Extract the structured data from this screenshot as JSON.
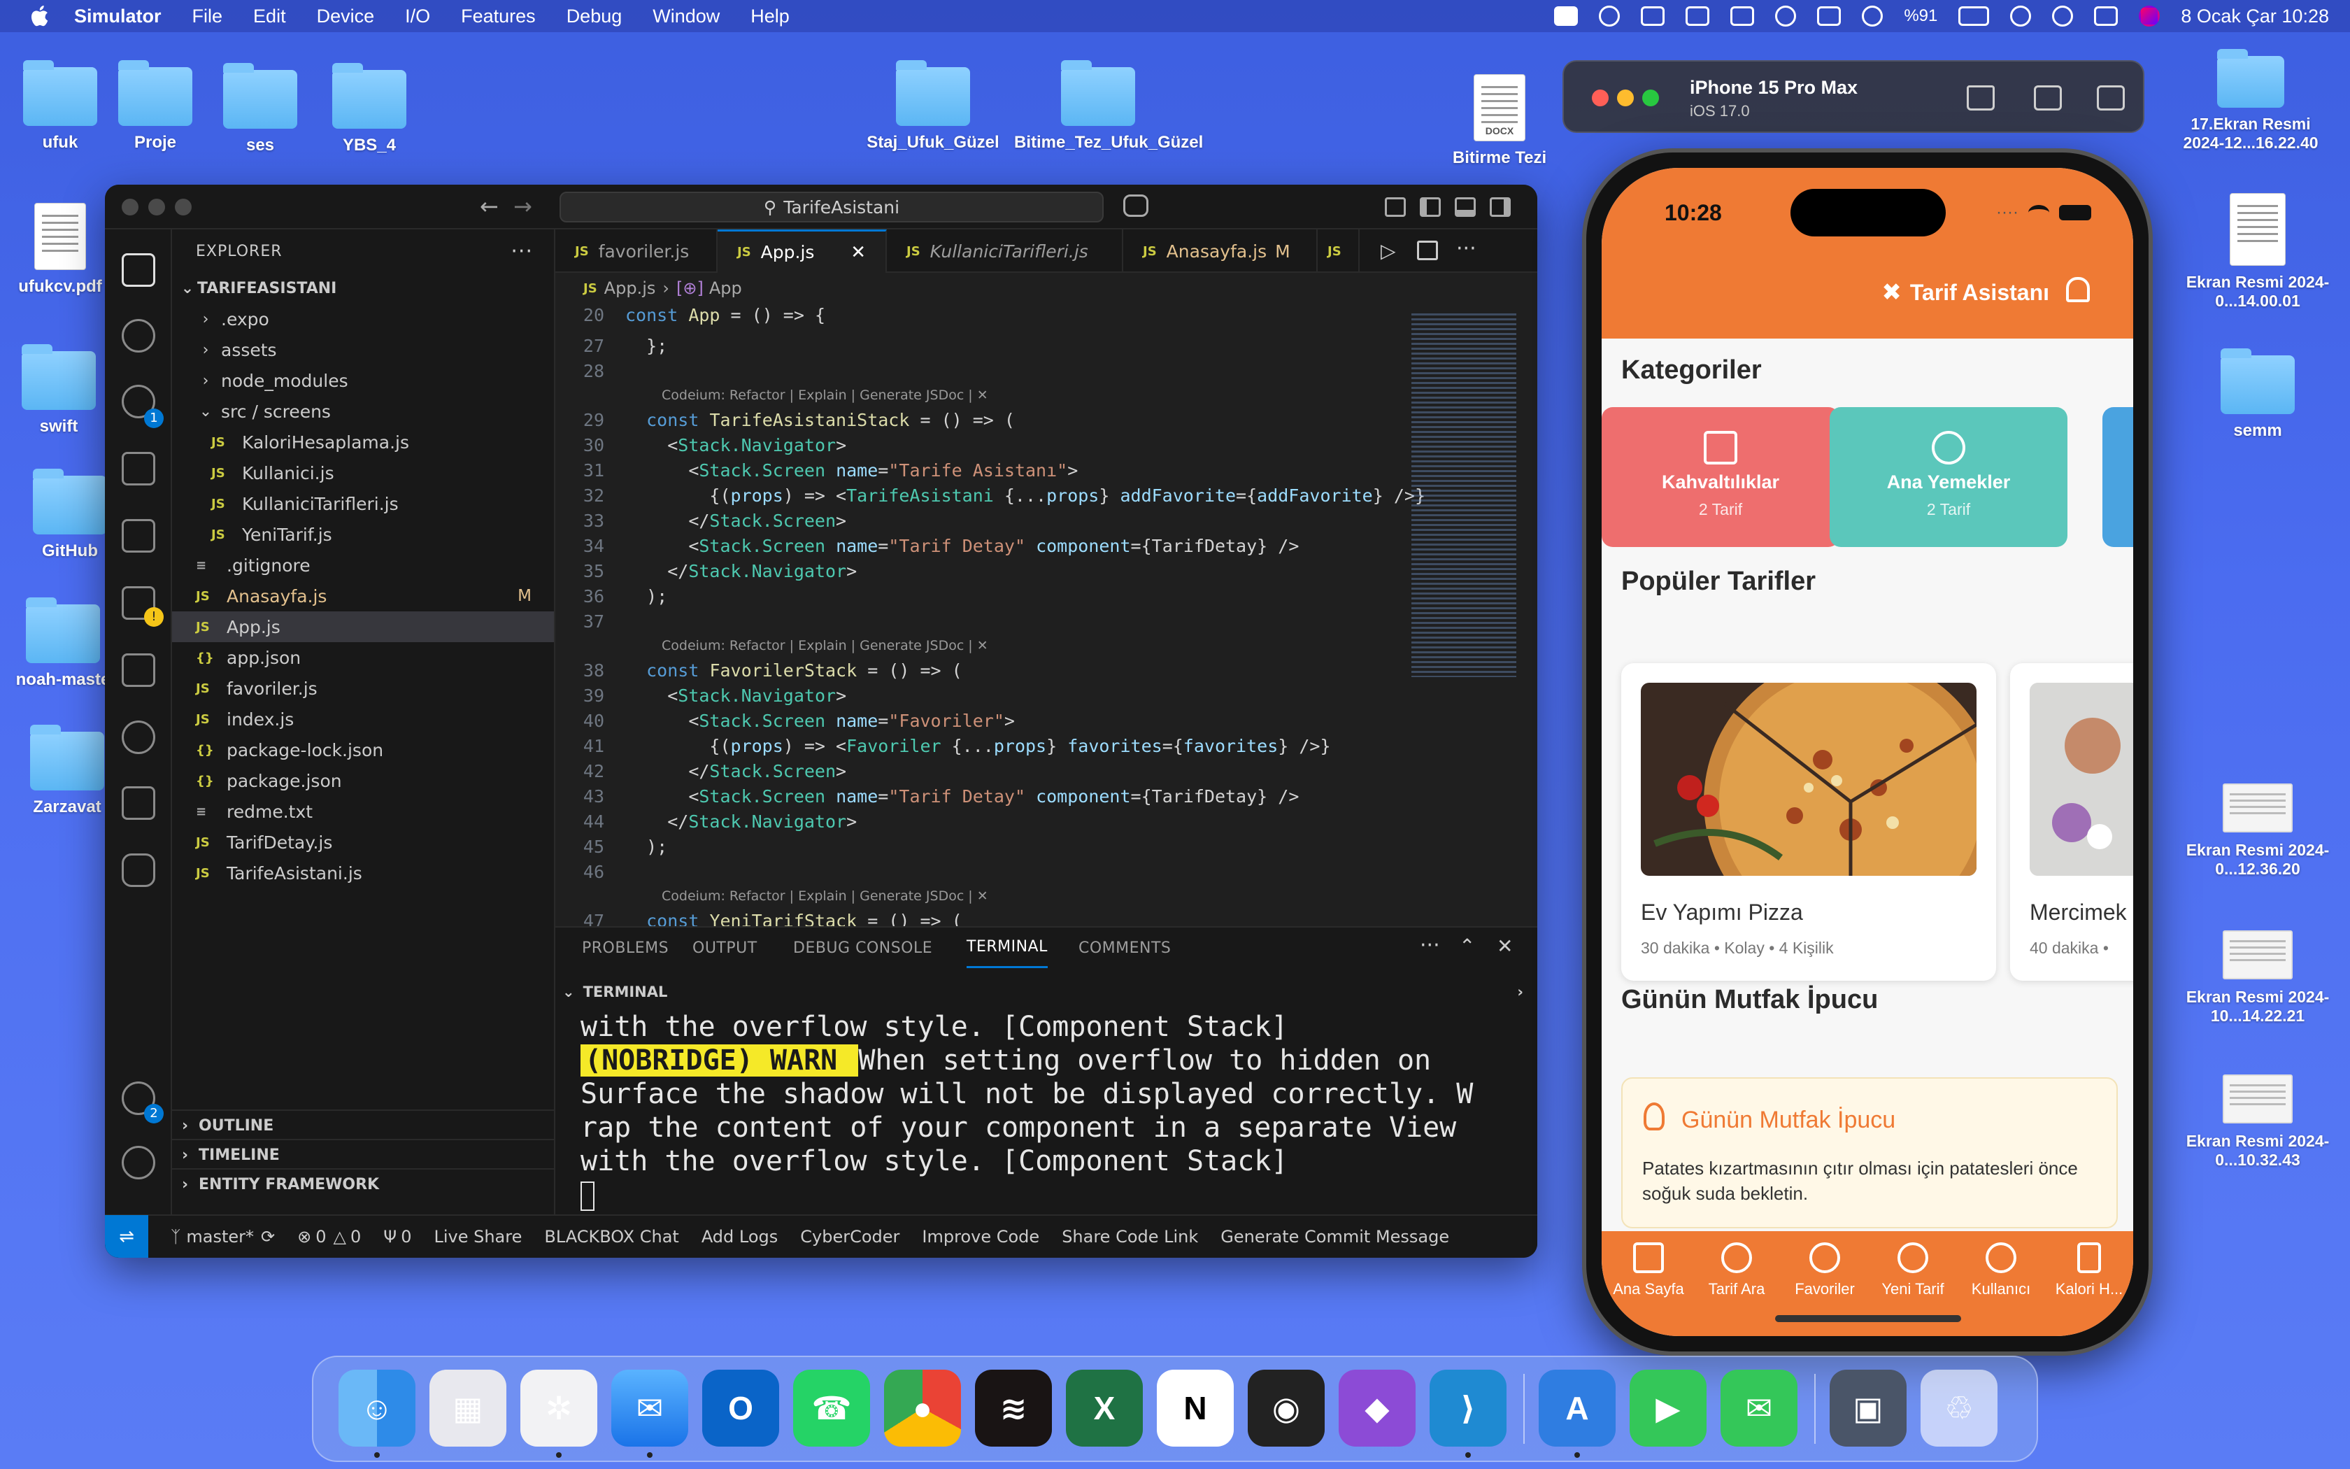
{
  "menubar": {
    "app_name": "Simulator",
    "items": [
      "File",
      "Edit",
      "Device",
      "I/O",
      "Features",
      "Debug",
      "Window",
      "Help"
    ],
    "battery": "%91",
    "clock": "8 Ocak Çar  10:28"
  },
  "desktop_icons": [
    {
      "label": "ufuk",
      "kind": "folder"
    },
    {
      "label": "Proje",
      "kind": "folder"
    },
    {
      "label": "ses",
      "kind": "folder"
    },
    {
      "label": "YBS_4",
      "kind": "folder"
    },
    {
      "label": "Staj_Ufuk_Güzel",
      "kind": "folder"
    },
    {
      "label": "Bitime_Tez_Ufuk_Güzel",
      "kind": "folder"
    },
    {
      "label": "Bitirme Tezi",
      "kind": "docx"
    },
    {
      "label": "ufukcv.pdf",
      "kind": "document"
    },
    {
      "label": "swift",
      "kind": "folder"
    },
    {
      "label": "GitHub",
      "kind": "folder"
    },
    {
      "label": "noah-maste",
      "kind": "folder"
    },
    {
      "label": "Zarzavat",
      "kind": "folder"
    },
    {
      "label": "semm",
      "kind": "folder"
    }
  ],
  "screenshots_right": [
    {
      "label": "17.Ekran Resmi 2024-12...16.22.40"
    },
    {
      "label": "Ekran Resmi 2024-0...14.00.01"
    },
    {
      "label": "Ekran Resmi 2024-0...12.36.20"
    },
    {
      "label": "Ekran Resmi 2024-10...14.22.21"
    },
    {
      "label": "Ekran Resmi 2024-0...10.32.43"
    }
  ],
  "vscode": {
    "search_text": "TarifeAsistani",
    "explorer_title": "EXPLORER",
    "project": "TARIFEASISTANI",
    "tree": [
      {
        "name": ".expo",
        "type": "folder",
        "depth": 1,
        "open": false
      },
      {
        "name": "assets",
        "type": "folder",
        "depth": 1,
        "open": false
      },
      {
        "name": "node_modules",
        "type": "folder",
        "depth": 1,
        "open": false
      },
      {
        "name": "src / screens",
        "type": "folder",
        "depth": 1,
        "open": true
      },
      {
        "name": "KaloriHesaplama.js",
        "type": "js",
        "depth": 2
      },
      {
        "name": "Kullanici.js",
        "type": "js",
        "depth": 2
      },
      {
        "name": "KullaniciTarifleri.js",
        "type": "js",
        "depth": 2
      },
      {
        "name": "YeniTarif.js",
        "type": "js",
        "depth": 2
      },
      {
        "name": ".gitignore",
        "type": "txt",
        "depth": 1
      },
      {
        "name": "Anasayfa.js",
        "type": "js",
        "depth": 1,
        "badge": "M"
      },
      {
        "name": "App.js",
        "type": "js",
        "depth": 1,
        "selected": true
      },
      {
        "name": "app.json",
        "type": "json",
        "depth": 1
      },
      {
        "name": "favoriler.js",
        "type": "js",
        "depth": 1
      },
      {
        "name": "index.js",
        "type": "js",
        "depth": 1
      },
      {
        "name": "package-lock.json",
        "type": "json",
        "depth": 1
      },
      {
        "name": "package.json",
        "type": "json",
        "depth": 1
      },
      {
        "name": "redme.txt",
        "type": "txt",
        "depth": 1
      },
      {
        "name": "TarifDetay.js",
        "type": "js",
        "depth": 1
      },
      {
        "name": "TarifeAsistani.js",
        "type": "js",
        "depth": 1
      }
    ],
    "sections": [
      "OUTLINE",
      "TIMELINE",
      "ENTITY FRAMEWORK"
    ],
    "tabs": [
      {
        "name": "favoriler.js"
      },
      {
        "name": "App.js",
        "active": true
      },
      {
        "name": "KullaniciTarifleri.js",
        "italic": true
      },
      {
        "name": "Anasayfa.js",
        "badge": "M"
      },
      {
        "name": ""
      }
    ],
    "breadcrumb": [
      "App.js",
      "App"
    ],
    "codelens": "Codeium: Refactor | Explain | Generate JSDoc | ✕",
    "code": [
      {
        "n": "20",
        "t": "const App = () => {"
      },
      {
        "n": "27",
        "t": "  };"
      },
      {
        "n": "28",
        "t": ""
      },
      {
        "n": "29",
        "t": "  const TarifeAsistaniStack = () => (",
        "lens": true
      },
      {
        "n": "30",
        "t": "    <Stack.Navigator>"
      },
      {
        "n": "31",
        "t": "      <Stack.Screen name=\"Tarife Asistanı\">"
      },
      {
        "n": "32",
        "t": "        {(props) => <TarifeAsistani {...props} addFavorite={addFavorite} />}"
      },
      {
        "n": "33",
        "t": "      </Stack.Screen>"
      },
      {
        "n": "34",
        "t": "      <Stack.Screen name=\"Tarif Detay\" component={TarifDetay} />"
      },
      {
        "n": "35",
        "t": "    </Stack.Navigator>"
      },
      {
        "n": "36",
        "t": "  );"
      },
      {
        "n": "37",
        "t": ""
      },
      {
        "n": "38",
        "t": "  const FavorilerStack = () => (",
        "lens": true
      },
      {
        "n": "39",
        "t": "    <Stack.Navigator>"
      },
      {
        "n": "40",
        "t": "      <Stack.Screen name=\"Favoriler\">"
      },
      {
        "n": "41",
        "t": "        {(props) => <Favoriler {...props} favorites={favorites} />}"
      },
      {
        "n": "42",
        "t": "      </Stack.Screen>"
      },
      {
        "n": "43",
        "t": "      <Stack.Screen name=\"Tarif Detay\" component={TarifDetay} />"
      },
      {
        "n": "44",
        "t": "    </Stack.Navigator>"
      },
      {
        "n": "45",
        "t": "  );"
      },
      {
        "n": "46",
        "t": ""
      },
      {
        "n": "47",
        "t": "  const YeniTarifStack = () => (",
        "lens": true
      }
    ],
    "panel_tabs": [
      "PROBLEMS",
      "OUTPUT",
      "DEBUG CONSOLE",
      "TERMINAL",
      "COMMENTS"
    ],
    "terminal_title": "TERMINAL",
    "terminal": {
      "line1": "with the overflow style. [Component Stack]",
      "warn_tag": " (NOBRIDGE) WARN ",
      "line2_rest": " When setting overflow to hidden on",
      "line3": "Surface the shadow will not be displayed correctly. W",
      "line4": "rap the content of your component in a separate View",
      "line5": "with the overflow style. [Component Stack]"
    },
    "status": {
      "branch": "master*",
      "errors": "0",
      "warnings": "0",
      "ports": "0",
      "items": [
        "Live Share",
        "BLACKBOX Chat",
        "Add Logs",
        "CyberCoder",
        "Improve Code",
        "Share Code Link",
        "Generate Commit Message"
      ]
    }
  },
  "simulator": {
    "device": "iPhone 15 Pro Max",
    "os": "iOS 17.0"
  },
  "phone": {
    "time": "10:28",
    "app_title": "Tarif Asistanı",
    "categories_title": "Kategoriler",
    "categories": [
      {
        "name": "Kahvaltılıklar",
        "count": "2 Tarif",
        "color": "#ee6e6e"
      },
      {
        "name": "Ana Yemekler",
        "count": "2 Tarif",
        "color": "#5bc7bb"
      }
    ],
    "popular_title": "Popüler Tarifler",
    "recipes": [
      {
        "name": "Ev Yapımı Pizza",
        "meta": "30 dakika • Kolay • 4 Kişilik"
      },
      {
        "name": "Mercimek",
        "meta": "40 dakika •"
      }
    ],
    "tip_section_title": "Günün Mutfak İpucu",
    "tip_card_title": "Günün Mutfak İpucu",
    "tip_text": "Patates kızartmasının çıtır olması için patatesleri önce soğuk suda bekletin.",
    "tabs": [
      "Ana Sayfa",
      "Tarif Ara",
      "Favoriler",
      "Yeni Tarif",
      "Kullanıcı",
      "Kalori H..."
    ]
  },
  "dock_apps": [
    "Finder",
    "Launchpad",
    "Safari",
    "Mail",
    "Outlook",
    "WhatsApp",
    "Chrome",
    "Spotify",
    "Excel",
    "Notion",
    "Logic",
    "Visual Studio",
    "VS Code",
    "Xcode",
    "FaceTime",
    "Messages",
    "Simulator",
    "Trash"
  ],
  "colors": {
    "accent": "#ef7a34",
    "vscode_blue": "#0078d4",
    "warn_yellow": "#f5e928"
  }
}
